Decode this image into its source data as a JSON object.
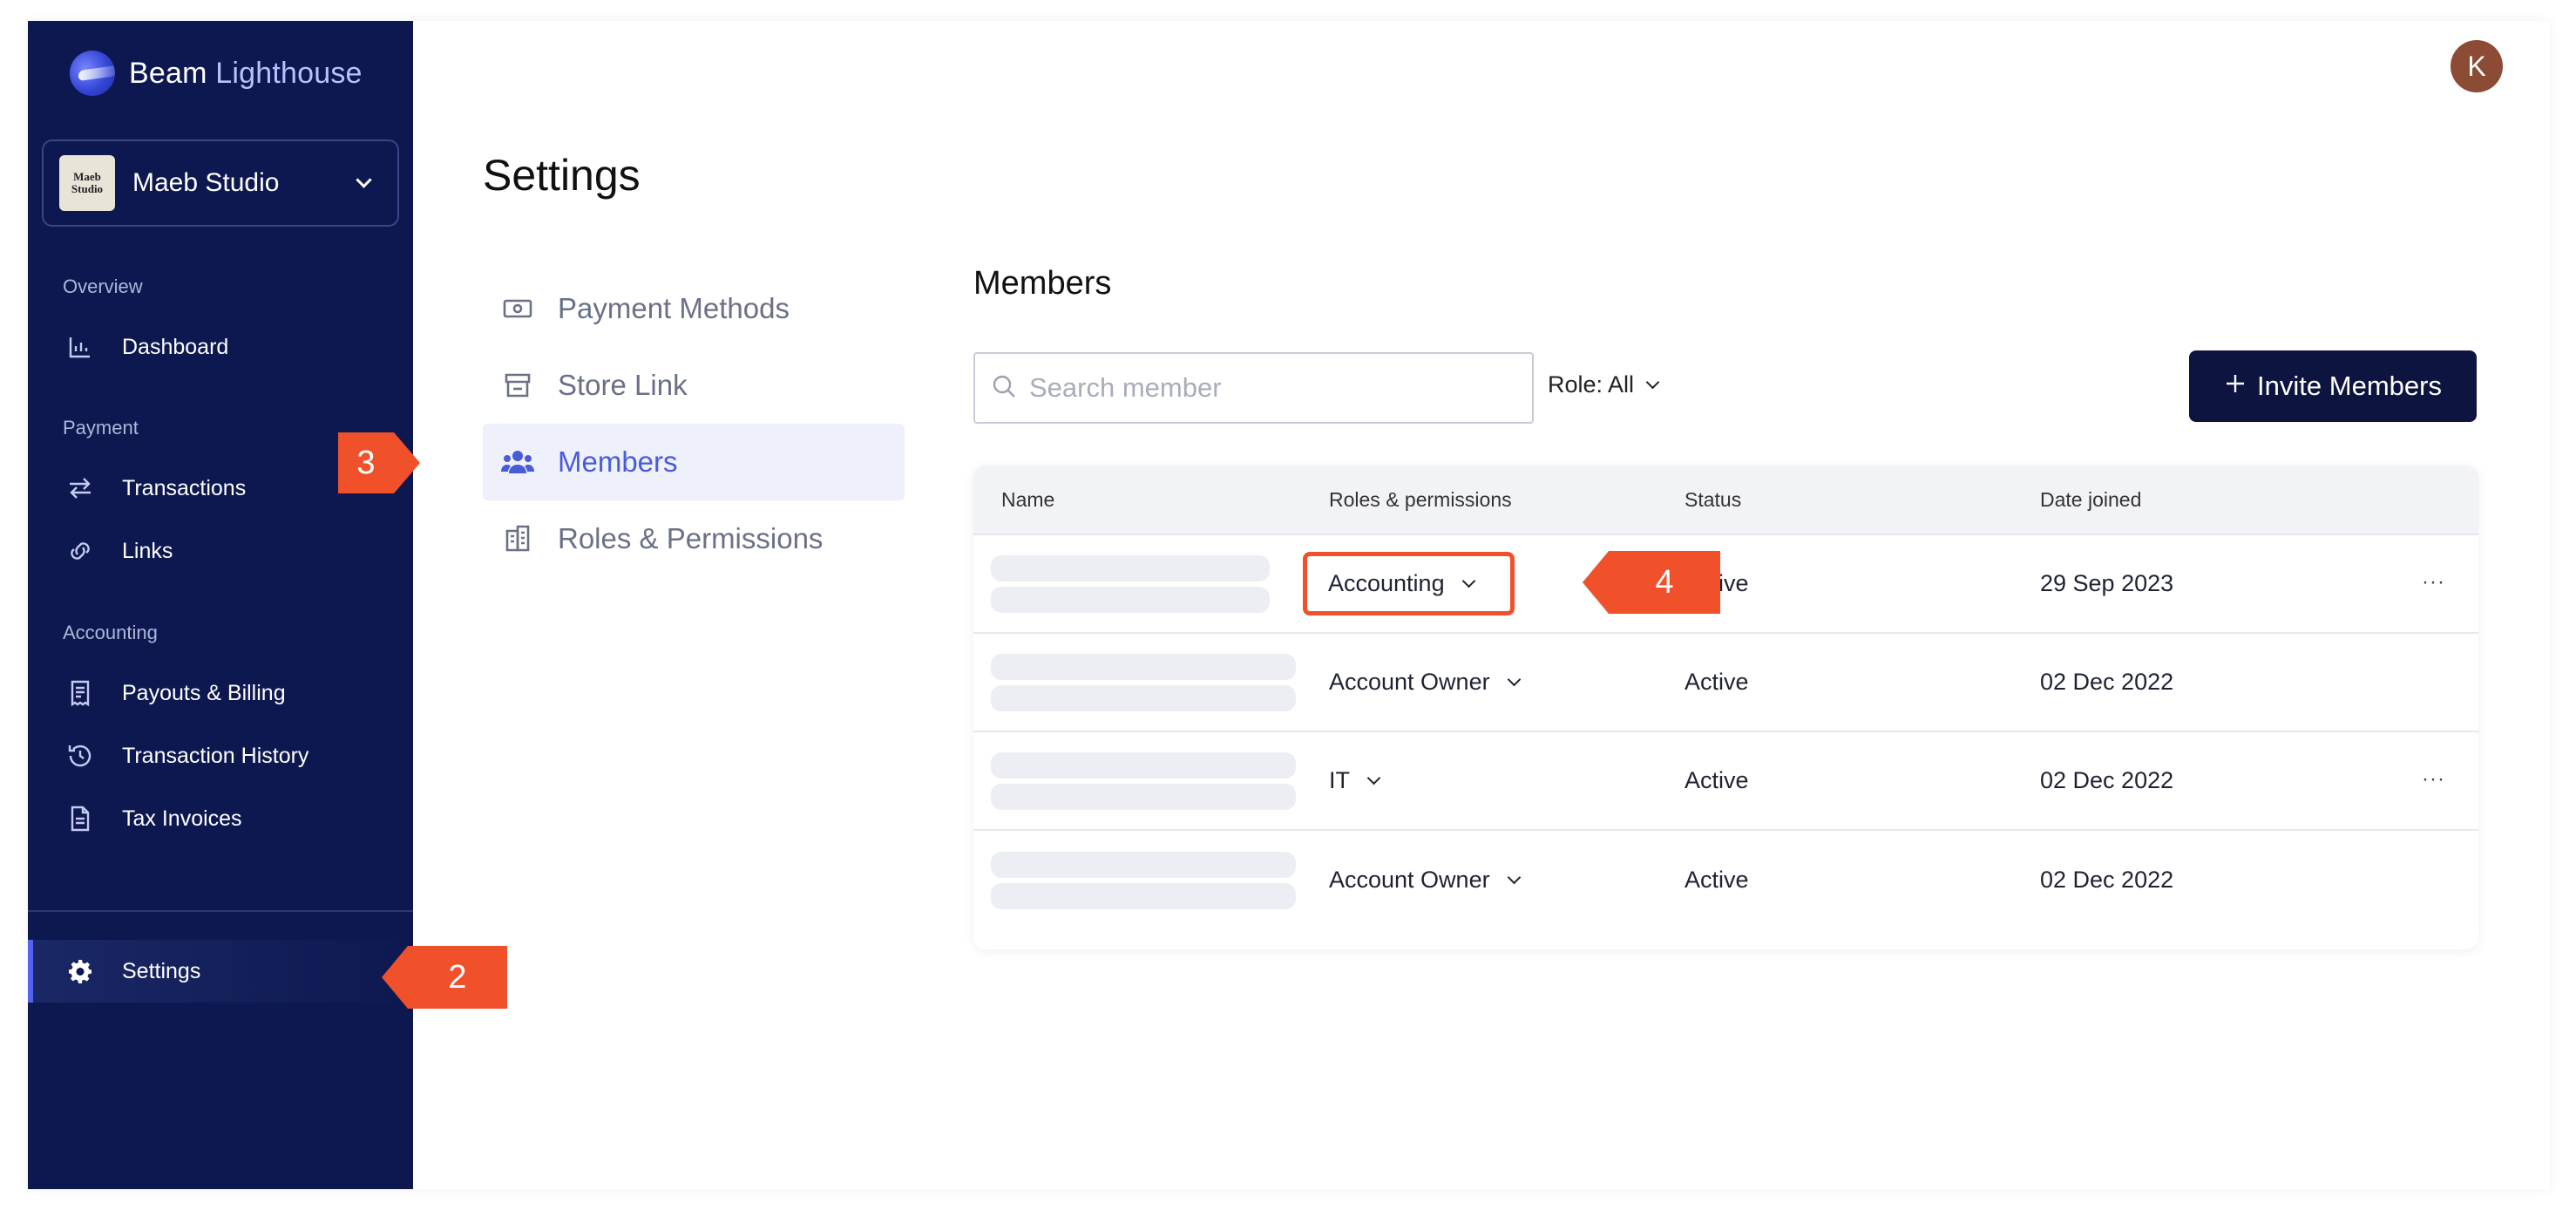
{
  "brand": {
    "name_part1": "Beam",
    "name_part2": " Lighthouse"
  },
  "store": {
    "name": "Maeb Studio",
    "avatar_text": "Maeb Studio"
  },
  "sidebar": {
    "sections": {
      "overview": "Overview",
      "payment": "Payment",
      "accounting": "Accounting"
    },
    "items": {
      "dashboard": "Dashboard",
      "transactions": "Transactions",
      "links": "Links",
      "payouts": "Payouts & Billing",
      "history": "Transaction History",
      "tax": "Tax Invoices",
      "settings": "Settings"
    }
  },
  "user": {
    "initial": "K"
  },
  "page": {
    "title": "Settings"
  },
  "subnav": [
    {
      "label": "Payment Methods"
    },
    {
      "label": "Store Link"
    },
    {
      "label": "Members"
    },
    {
      "label": "Roles & Permissions"
    }
  ],
  "members": {
    "title": "Members",
    "search_placeholder": "Search member",
    "role_filter": "Role: All",
    "invite_label": "Invite Members",
    "columns": [
      "Name",
      "Roles & permissions",
      "Status",
      "Date joined"
    ],
    "rows": [
      {
        "role": "Accounting",
        "status": "Active",
        "date": "29 Sep 2023",
        "more": "···"
      },
      {
        "role": "Account Owner",
        "status": "Active",
        "date": "02 Dec 2022",
        "more": ""
      },
      {
        "role": "IT",
        "status": "Active",
        "date": "02 Dec 2022",
        "more": "···"
      },
      {
        "role": "Account Owner",
        "status": "Active",
        "date": "02 Dec 2022",
        "more": ""
      }
    ]
  },
  "callouts": {
    "two": "2",
    "three": "3",
    "four": "4"
  },
  "colors": {
    "sidebar": "#0e1850",
    "accent": "#4a5bd8",
    "callout": "#f0502a",
    "button": "#0d1440"
  }
}
